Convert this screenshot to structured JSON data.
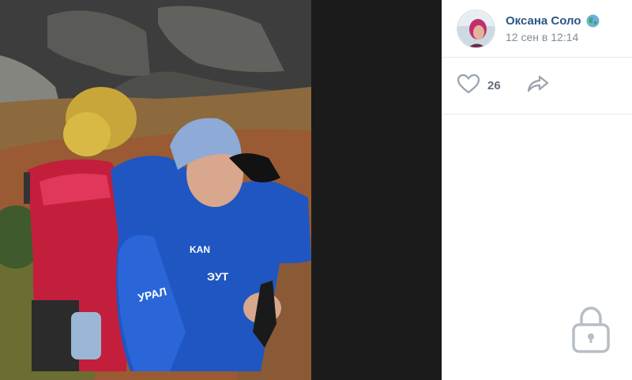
{
  "post": {
    "author_name": "Оксана Соло",
    "date": "12 сен в 12:14",
    "likes_count": "26"
  },
  "photo": {
    "jacket_text_left": "УРАЛ",
    "jacket_text_chest": "ЭУТ",
    "jacket_brand": "KAN"
  },
  "icons": {
    "like": "heart-outline-icon",
    "share": "share-arrow-icon",
    "globe": "globe-icon",
    "lock": "lock-icon"
  },
  "colors": {
    "author_link": "#2a5885",
    "meta_text": "#818c99",
    "icon_gray": "#99a2ad",
    "divider": "#e7e8ec"
  }
}
